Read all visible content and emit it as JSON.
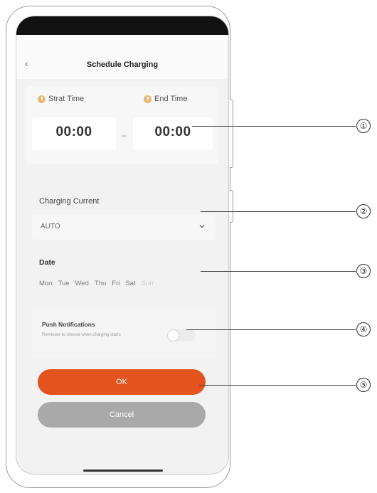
{
  "header": {
    "title": "Schedule Charging"
  },
  "time": {
    "start_label": "Strat Time",
    "end_label": "End Time",
    "start_value": "00:00",
    "end_value": "00:00",
    "separator": "–"
  },
  "current": {
    "label": "Charging Current",
    "value": "AUTO"
  },
  "date": {
    "label": "Date",
    "days": [
      "Mon",
      "Tue",
      "Wed",
      "Thu",
      "Fri",
      "Sat",
      "Sun"
    ]
  },
  "push": {
    "title": "Push Notifications",
    "description": "Reminder to choose when charging starts",
    "enabled": false
  },
  "buttons": {
    "ok": "OK",
    "cancel": "Cancel"
  },
  "callouts": [
    "①",
    "②",
    "③",
    "④",
    "⑤"
  ],
  "colors": {
    "accent": "#e3531d",
    "cancel": "#a9a9a9",
    "clock": "#e8b87a"
  }
}
